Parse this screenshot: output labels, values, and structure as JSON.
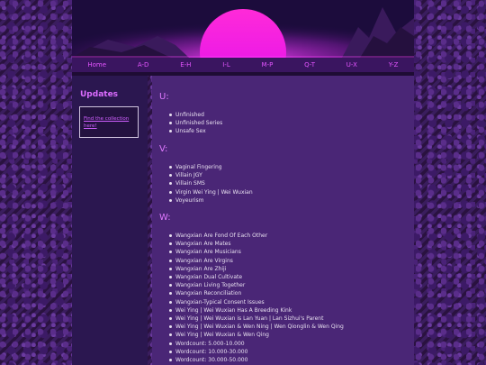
{
  "nav": {
    "items": [
      "Home",
      "A-D",
      "E-H",
      "I-L",
      "M-P",
      "Q-T",
      "U-X",
      "Y-Z"
    ]
  },
  "sidebar": {
    "title": "Updates",
    "link_text": "Find the collection here!"
  },
  "sections": [
    {
      "heading": "U:",
      "items": [
        "Unfinished",
        "Unfinished Series",
        "Unsafe Sex"
      ]
    },
    {
      "heading": "V:",
      "items": [
        "Vaginal Fingering",
        "Villain JGY",
        "Villain SMS",
        "Virgin Wei Ying | Wei Wuxian",
        "Voyeurism"
      ]
    },
    {
      "heading": "W:",
      "items": [
        "Wangxian Are Fond Of Each Other",
        "Wangxian Are Mates",
        "Wangxian Are Musicians",
        "Wangxian Are Virgins",
        "Wangxian Are Zhiji",
        "Wangxian Dual Cultivate",
        "Wangxian Living Together",
        "Wangxian Reconciliation",
        "Wangxian-Typical Consent Issues",
        "Wei Ying | Wei Wuxian Has A Breeding Kink",
        "Wei Ying | Wei Wuxian is Lan Yuan | Lan Sizhui's Parent",
        "Wei Ying | Wei Wuxian & Wen Ning | Wen Qionglin & Wen Qing",
        "Wei Ying | Wei Wuxian & Wen Qing",
        "Wordcount: 5.000-10.000",
        "Wordcount: 10.000-30.000",
        "Wordcount: 30.000-50.000"
      ]
    }
  ],
  "colors": {
    "accent": "#e455ff",
    "heading": "#e07aff",
    "main_bg": "#4a2676",
    "sidebar_bg": "#2b1750"
  }
}
